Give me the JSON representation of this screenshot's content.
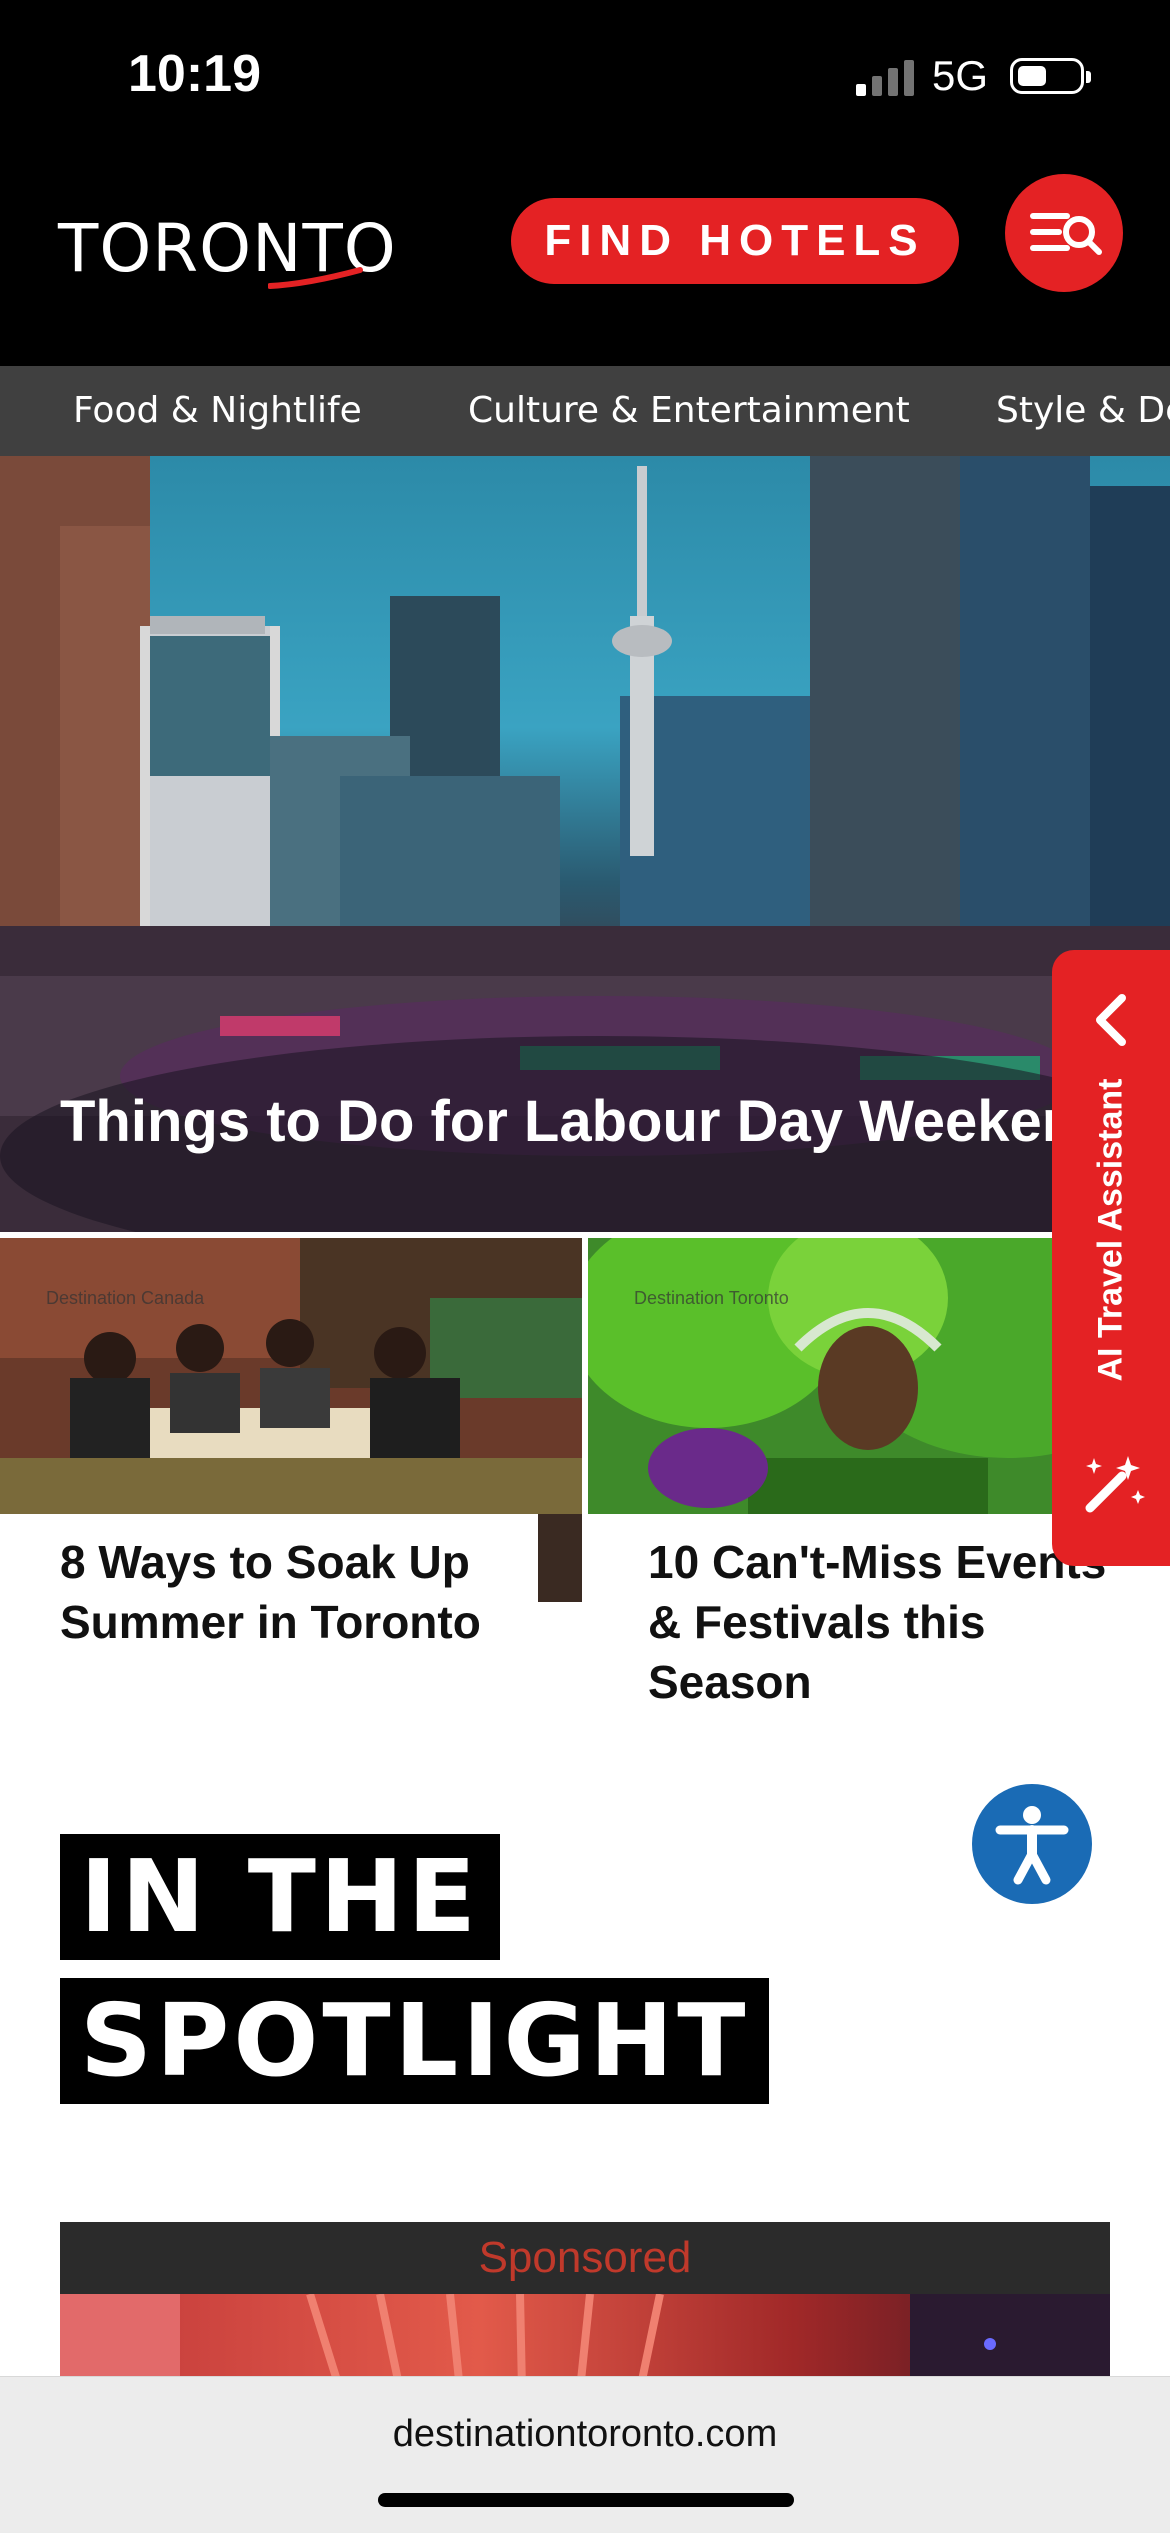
{
  "status_bar": {
    "time": "10:19",
    "network": "5G"
  },
  "header": {
    "logo_text": "TORONTO",
    "find_hotels_label": "FIND HOTELS"
  },
  "categories": [
    "Food & Nightlife",
    "Culture & Entertainment",
    "Style & De"
  ],
  "hero": {
    "title": "Things to Do for Labour Day Weeken"
  },
  "cards": [
    {
      "credit": "Destination Canada",
      "title": "8 Ways to Soak Up Summer in Toronto"
    },
    {
      "credit": "Destination Toronto",
      "title": "10 Can't-Miss Events & Festivals this Season"
    }
  ],
  "ai_assistant": {
    "label": "AI Travel Assistant"
  },
  "spotlight": {
    "line1": "IN THE",
    "line2": "SPOTLIGHT"
  },
  "sponsored": {
    "label": "Sponsored"
  },
  "browser": {
    "url": "destinationtoronto.com"
  },
  "colors": {
    "brand_red": "#e42224",
    "accessibility_blue": "#1a6bb5",
    "nav_gray": "#404040"
  },
  "icons": [
    "menu-search-icon",
    "chevron-left-icon",
    "magic-wand-icon",
    "accessibility-icon",
    "signal-icon",
    "battery-icon"
  ]
}
